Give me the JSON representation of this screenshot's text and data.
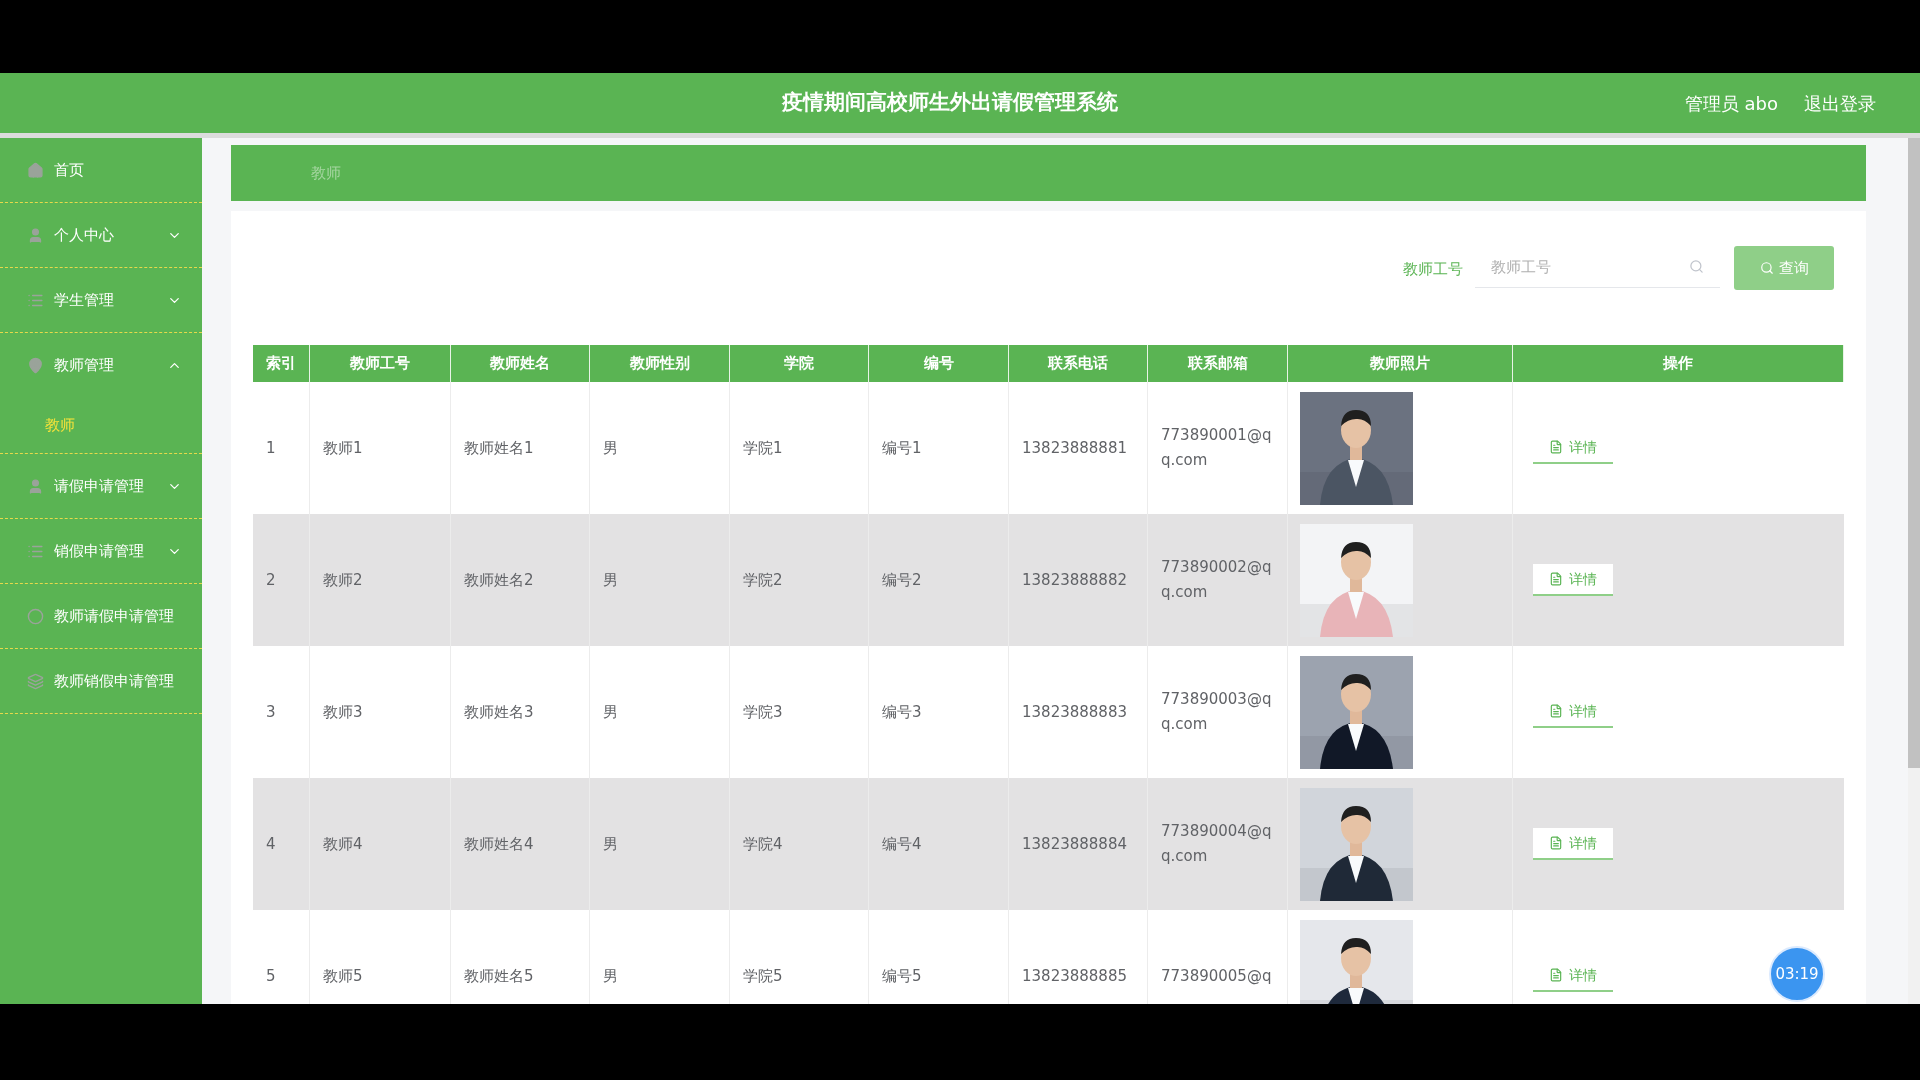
{
  "header": {
    "title": "疫情期间高校师生外出请假管理系统",
    "user": "管理员 abo",
    "logout": "退出登录"
  },
  "sidebar": {
    "items": [
      {
        "label": "首页",
        "selected": false
      },
      {
        "label": "个人中心",
        "selected": false,
        "expanded": false
      },
      {
        "label": "学生管理",
        "selected": false,
        "expanded": false
      },
      {
        "label": "教师管理",
        "selected": false,
        "expanded": true,
        "children": [
          {
            "label": "教师",
            "selected": true
          }
        ]
      },
      {
        "label": "请假申请管理",
        "selected": false,
        "expanded": false
      },
      {
        "label": "销假申请管理",
        "selected": false,
        "expanded": false
      },
      {
        "label": "教师请假申请管理",
        "selected": false
      },
      {
        "label": "教师销假申请管理",
        "selected": false
      }
    ]
  },
  "breadcrumb": "教师",
  "search": {
    "label": "教师工号",
    "placeholder": "教师工号",
    "button": "查询"
  },
  "table": {
    "columns": [
      "索引",
      "教师工号",
      "教师姓名",
      "教师性别",
      "学院",
      "编号",
      "联系电话",
      "联系邮箱",
      "教师照片",
      "操作"
    ],
    "rows": [
      {
        "cells": [
          "1",
          "教师1",
          "教师姓名1",
          "男",
          "学院1",
          "编号1",
          "13823888881",
          "773890001@qq.com"
        ],
        "action": "详情"
      },
      {
        "cells": [
          "2",
          "教师2",
          "教师姓名2",
          "男",
          "学院2",
          "编号2",
          "13823888882",
          "773890002@qq.com"
        ],
        "action": "详情"
      },
      {
        "cells": [
          "3",
          "教师3",
          "教师姓名3",
          "男",
          "学院3",
          "编号3",
          "13823888883",
          "773890003@qq.com"
        ],
        "action": "详情"
      },
      {
        "cells": [
          "4",
          "教师4",
          "教师姓名4",
          "男",
          "学院4",
          "编号4",
          "13823888884",
          "773890004@qq.com"
        ],
        "action": "详情"
      },
      {
        "cells": [
          "5",
          "教师5",
          "教师姓名5",
          "男",
          "学院5",
          "编号5",
          "13823888885",
          "773890005@q"
        ],
        "action": "详情"
      }
    ]
  },
  "timer_badge": "03:19"
}
